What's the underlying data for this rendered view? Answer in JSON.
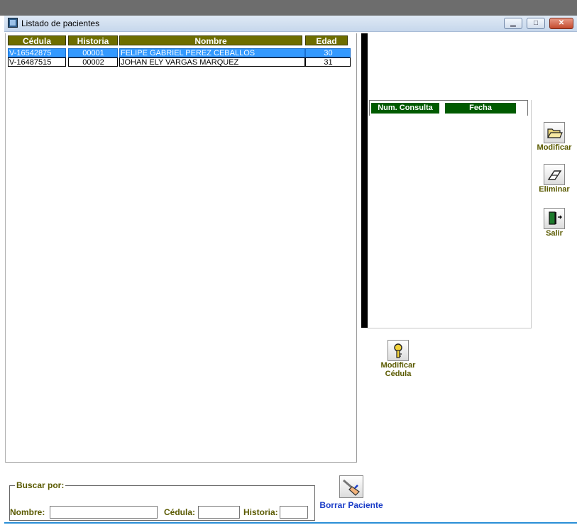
{
  "window": {
    "title": "Listado de pacientes",
    "minimize_glyph": "▁",
    "maximize_glyph": "□",
    "close_glyph": "✕"
  },
  "patients": {
    "columns": [
      "Cédula",
      "Historia",
      "Nombre",
      "Edad"
    ],
    "rows": [
      {
        "cedula": "V-16542875",
        "historia": "00001",
        "nombre": "FELIPE GABRIEL PEREZ CEBALLOS",
        "edad": "30",
        "selected": true
      },
      {
        "cedula": "V-16487515",
        "historia": "00002",
        "nombre": "JOHAN ELY VARGAS MARQUEZ",
        "edad": "31",
        "selected": false
      }
    ]
  },
  "consultas": {
    "columns": [
      "Num. Consulta",
      "Fecha"
    ]
  },
  "actions": {
    "modificar": {
      "label": "Modificar",
      "icon": "folder-open-icon"
    },
    "eliminar": {
      "label": "Eliminar",
      "icon": "eraser-icon"
    },
    "salir": {
      "label": "Salir",
      "icon": "exit-door-icon"
    },
    "modificar_cedula": {
      "label_line1": "Modificar",
      "label_line2": "Cédula",
      "icon": "key-icon"
    },
    "borrar_paciente": {
      "label": "Borrar Paciente",
      "icon": "broom-icon"
    }
  },
  "search": {
    "legend": "Buscar por:",
    "nombre_label": "Nombre:",
    "nombre_value": "",
    "cedula_label": "Cédula:",
    "cedula_value": "",
    "historia_label": "Historia:",
    "historia_value": ""
  },
  "colors": {
    "header_olive": "#6e6e00",
    "header_green": "#005a00",
    "selection": "#3399ff",
    "label_olive": "#5a5a00",
    "label_blue": "#1a3cc7"
  }
}
